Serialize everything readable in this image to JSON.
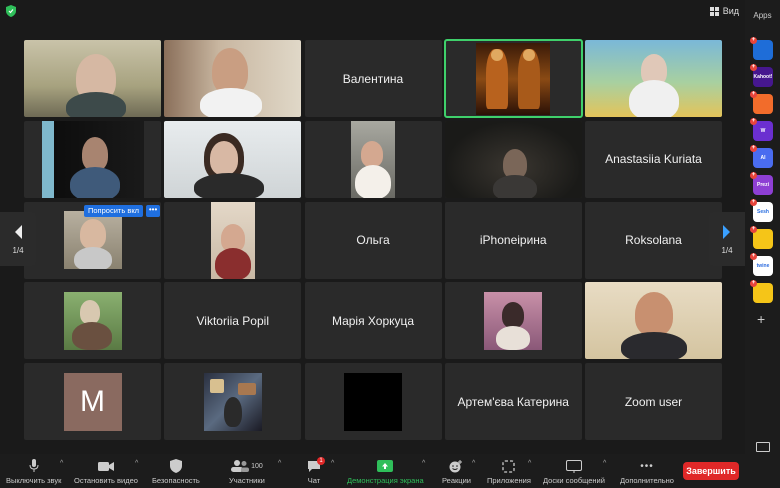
{
  "topbar": {
    "view_label": "Вид"
  },
  "apps_panel": {
    "label": "Apps",
    "icons": [
      {
        "name": "play-app-icon",
        "text": "",
        "bg": "#1e6dd8",
        "fg": "#fff"
      },
      {
        "name": "kahoot-app-icon",
        "text": "Kahoot!",
        "bg": "#46178f",
        "fg": "#fff"
      },
      {
        "name": "orange-app-icon",
        "text": "",
        "bg": "#f26c2b",
        "fg": "#fff"
      },
      {
        "name": "wordwall-app-icon",
        "text": "W",
        "bg": "#6b2fd0",
        "fg": "#fff"
      },
      {
        "name": "ai-app-icon",
        "text": "AI",
        "bg": "#4a6cf0",
        "fg": "#fff"
      },
      {
        "name": "prezi-app-icon",
        "text": "Prezi",
        "bg": "#8e3fd4",
        "fg": "#fff"
      },
      {
        "name": "sesh-app-icon",
        "text": "Sesh",
        "bg": "#ffffff",
        "fg": "#2a6fe0"
      },
      {
        "name": "smiley-app-icon",
        "text": "",
        "bg": "#f5c518",
        "fg": "#000"
      },
      {
        "name": "twine-app-icon",
        "text": "twine",
        "bg": "#ffffff",
        "fg": "#2d6cdf"
      },
      {
        "name": "grid-app-icon",
        "text": "",
        "bg": "#f5c518",
        "fg": "#000"
      }
    ]
  },
  "navigation": {
    "left_page": "1/4",
    "right_page": "1/4"
  },
  "participants": [
    {
      "type": "video",
      "name": ""
    },
    {
      "type": "video",
      "name": ""
    },
    {
      "type": "name",
      "name": "Валентина"
    },
    {
      "type": "video",
      "name": "",
      "active": true
    },
    {
      "type": "video",
      "name": ""
    },
    {
      "type": "video",
      "name": ""
    },
    {
      "type": "video",
      "name": ""
    },
    {
      "type": "video",
      "name": ""
    },
    {
      "type": "video",
      "name": ""
    },
    {
      "type": "name",
      "name": "Anastasiia Kuriata"
    },
    {
      "type": "video",
      "name": ""
    },
    {
      "type": "video",
      "name": ""
    },
    {
      "type": "name",
      "name": "Ольга"
    },
    {
      "type": "name",
      "name": "iPhoneірина"
    },
    {
      "type": "name",
      "name": "Roksolana"
    },
    {
      "type": "video",
      "name": ""
    },
    {
      "type": "name",
      "name": "Viktoriia Popil"
    },
    {
      "type": "name",
      "name": "Марія Хоркуца"
    },
    {
      "type": "video",
      "name": ""
    },
    {
      "type": "video",
      "name": ""
    },
    {
      "type": "avatar",
      "name": "",
      "initial": "M"
    },
    {
      "type": "video",
      "name": ""
    },
    {
      "type": "video",
      "name": ""
    },
    {
      "type": "name",
      "name": "Артем'єва Катерина"
    },
    {
      "type": "name",
      "name": "Zoom user"
    }
  ],
  "hover_menu": {
    "request_label": "Попросить вкл",
    "more_label": "•••"
  },
  "toolbar": {
    "mute": "Выключить звук",
    "video": "Остановить видео",
    "security": "Безопасность",
    "participants": "Участники",
    "participants_count": "100",
    "chat": "Чат",
    "chat_badge": "1",
    "share": "Демонстрация экрана",
    "reactions": "Реакции",
    "apps": "Приложения",
    "whiteboards": "Доски сообщений",
    "more": "Дополнительно",
    "end": "Завершить"
  },
  "colors": {
    "active_border": "#3fd06b",
    "share_green": "#2fbf5a",
    "end_red": "#e02828",
    "accent_blue": "#1f6fe0"
  }
}
